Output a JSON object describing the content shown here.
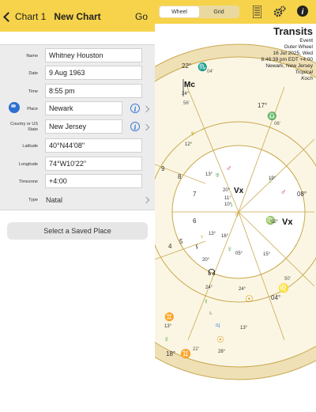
{
  "left_nav": {
    "back_label": "Chart 1",
    "title": "New Chart",
    "go_label": "Go"
  },
  "form": {
    "name_label": "Name",
    "name_value": "Whitney Houston",
    "date_label": "Date",
    "date_value": "9 Aug 1963",
    "time_label": "Time",
    "time_value": "8:55 pm",
    "place_label": "Place",
    "place_value": "Newark",
    "country_label": "Country or US State",
    "country_value": "New Jersey",
    "latitude_label": "Latitude",
    "latitude_value": "40°N44'08\"",
    "longitude_label": "Longitude",
    "longitude_value": "74°W10'22\"",
    "timezone_label": "Timezone",
    "timezone_value": "+4:00",
    "type_label": "Type",
    "type_value": "Natal"
  },
  "saved_place_button": "Select a Saved Place",
  "right_toolbar": {
    "tab_wheel": "Wheel",
    "tab_grid": "Grid",
    "icons": [
      "list-icon",
      "gear-icon",
      "info-icon"
    ]
  },
  "transits": {
    "title": "Transits",
    "line1": "Event",
    "line2": "Outer Wheel",
    "line3": "16 Jul 2025, Wed",
    "line4": "8:46:39 pm EDT +4:00",
    "line5": "Newark, New Jersey",
    "line6": "Tropical",
    "line7": "Koch"
  },
  "chart": {
    "house_numbers": [
      "9",
      "8",
      "7",
      "6",
      "5",
      "4"
    ],
    "sign_degrees": [
      {
        "label": "22°",
        "sign": "♏",
        "sign_color": "#2a7a3a"
      },
      {
        "label": "17°",
        "sign": "♎",
        "sign_color": "#2a8a2a"
      },
      {
        "label": "08°",
        "sign": "♍",
        "sign_color": "#2a7a2a"
      },
      {
        "label": "04°",
        "sign": "♌",
        "sign_color": "#d08a00"
      },
      {
        "label": "18°",
        "sign": "♊",
        "sign_color": "#d08a00"
      }
    ],
    "angles": {
      "mc": "Mc",
      "vx": "Vx",
      "vx_outer": "Vx"
    },
    "planet_labels": [
      "24°",
      "12°",
      "13°",
      "20°",
      "11°",
      "10°",
      "02°",
      "16°",
      "13°",
      "15°",
      "20°",
      "19°",
      "05°",
      "24°",
      "28°",
      "13°",
      "24°",
      "13°"
    ],
    "glyph_colors": {
      "mars": "#c62828",
      "venus": "#2e9e2e",
      "jupiter": "#1e5fd0",
      "sun": "#d08a00",
      "mercury": "#c9a400",
      "neptune": "#b8a000"
    }
  }
}
